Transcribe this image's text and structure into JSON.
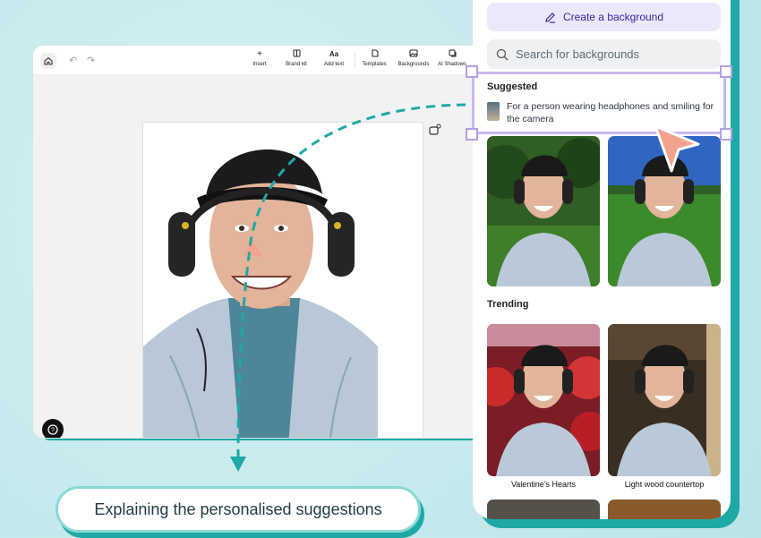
{
  "toolbar": {
    "tools": [
      {
        "label": "Insert",
        "icon": "plus-icon"
      },
      {
        "label": "Brand kit",
        "icon": "brand-kit-icon"
      },
      {
        "label": "Add text",
        "icon": "add-text-icon",
        "glyph": "Aa"
      },
      {
        "label": "Templates",
        "icon": "templates-icon"
      },
      {
        "label": "Backgrounds",
        "icon": "backgrounds-icon"
      },
      {
        "label": "AI Shadows",
        "icon": "ai-shadows-icon"
      }
    ]
  },
  "panel": {
    "create_label": "Create a background",
    "search_placeholder": "Search for backgrounds",
    "suggested_title": "Suggested",
    "suggested_text": "For a person wearing headphones and smiling for the camera",
    "trending_title": "Trending",
    "trending": [
      {
        "label": "Valentine's Hearts"
      },
      {
        "label": "Light wood countertop"
      }
    ]
  },
  "caption": "Explaining the personalised suggestions",
  "colors": {
    "accent_teal": "#1ea9a6",
    "accent_purple": "#3d23a0",
    "selection": "#c8b7ee",
    "cursor": "#f3a28e"
  }
}
